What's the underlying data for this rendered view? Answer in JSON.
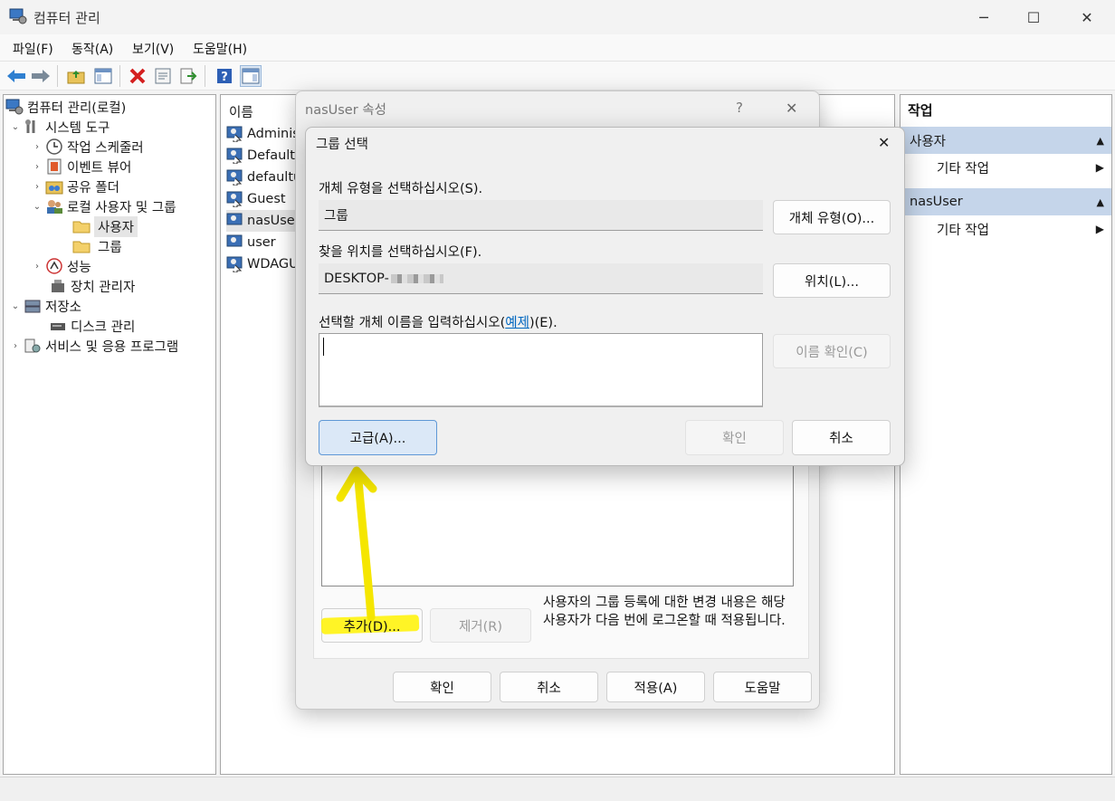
{
  "window": {
    "title": "컴퓨터 관리",
    "minimize": "─",
    "maximize": "☐",
    "close": "✕"
  },
  "menu": [
    "파일(F)",
    "동작(A)",
    "보기(V)",
    "도움말(H)"
  ],
  "toolbar_icons": [
    "back-arrow-icon",
    "forward-arrow-icon",
    "up-folder-icon",
    "show-hide-tree-icon",
    "delete-icon",
    "properties-icon",
    "export-icon",
    "help-icon",
    "action-pane-icon"
  ],
  "tree": {
    "root": "컴퓨터 관리(로컬)",
    "system_tools": "시스템 도구",
    "task_scheduler": "작업 스케줄러",
    "event_viewer": "이벤트 뷰어",
    "shared_folders": "공유 폴더",
    "local_users_groups": "로컬 사용자 및 그룹",
    "users": "사용자",
    "groups": "그룹",
    "performance": "성능",
    "device_manager": "장치 관리자",
    "storage": "저장소",
    "disk_management": "디스크 관리",
    "services_apps": "서비스 및 응용 프로그램"
  },
  "list": {
    "header_name": "이름",
    "users": [
      "Administ",
      "DefaultA",
      "defaultu",
      "Guest",
      "nasUser",
      "user",
      "WDAGU"
    ]
  },
  "actions": {
    "header": "작업",
    "section1": "사용자",
    "section1_item": "기타 작업",
    "section2": "nasUser",
    "section2_item": "기타 작업"
  },
  "properties_dialog": {
    "title": "nasUser 속성",
    "help": "?",
    "close": "✕",
    "add_button": "추가(D)...",
    "remove_button": "제거(R)",
    "info_text": "사용자의 그룹 등록에 대한 변경 내용은 해당 사용자가 다음 번에 로그온할 때 적용됩니다.",
    "ok": "확인",
    "cancel": "취소",
    "apply": "적용(A)",
    "help_button": "도움말"
  },
  "select_group_dialog": {
    "title": "그룹 선택",
    "close": "✕",
    "object_type_label": "개체 유형을 선택하십시오(S).",
    "object_type_value": "그룹",
    "object_type_button": "개체 유형(O)...",
    "location_label": "찾을 위치를 선택하십시오(F).",
    "location_value": "DESKTOP-",
    "location_button": "위치(L)...",
    "name_label_prefix": "선택할 개체 이름을 입력하십시오(",
    "name_label_link": "예제",
    "name_label_suffix": ")(E).",
    "name_input_value": "",
    "check_names_button": "이름 확인(C)",
    "advanced_button": "고급(A)...",
    "ok_button": "확인",
    "cancel_button": "취소"
  },
  "colors": {
    "accent": "#0067c0",
    "annotation": "#fff200",
    "action_section": "#c5d5ea"
  }
}
